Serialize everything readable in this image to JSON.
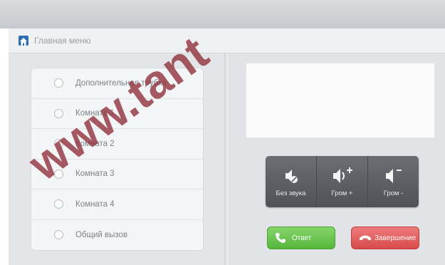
{
  "window": {
    "title": "Главная меню"
  },
  "list": {
    "items": [
      {
        "label": "Дополнительная трубка"
      },
      {
        "label": "Комната 1"
      },
      {
        "label": "Комната 2"
      },
      {
        "label": "Комната 3"
      },
      {
        "label": "Комната 4"
      },
      {
        "label": "Общий вызов"
      }
    ]
  },
  "volume": {
    "mute_label": "Без звука",
    "up_label": "Гром +",
    "down_label": "Гром -"
  },
  "call": {
    "answer_label": "Ответ",
    "hangup_label": "Завершение"
  },
  "watermark": {
    "text": "www.tant"
  },
  "colors": {
    "answer": "#5cbc43",
    "hangup": "#dc5252",
    "volume_panel": "#5d6166",
    "accent_icon": "#2e6db0"
  },
  "icons": {
    "home": "home-icon",
    "mute": "mute-icon",
    "volume_up": "volume-up-icon",
    "volume_down": "volume-down-icon",
    "answer": "phone-icon",
    "hangup": "phone-hangup-icon"
  }
}
